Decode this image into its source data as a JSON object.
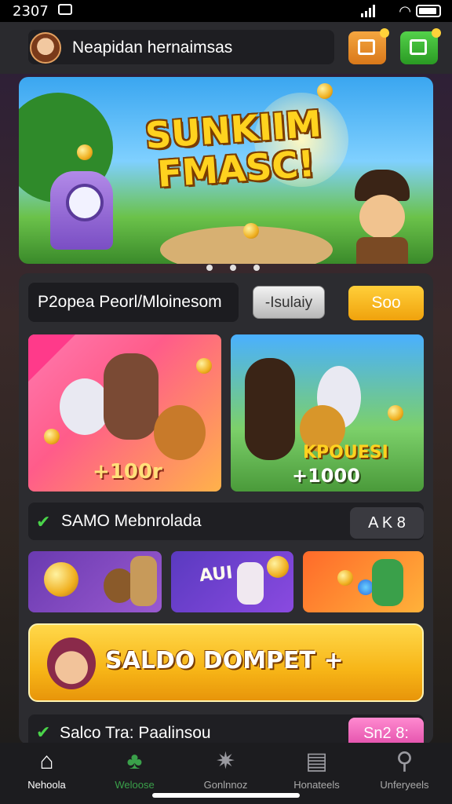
{
  "status_bar": {
    "time": "2307"
  },
  "header": {
    "username": "Neapidan hernaimsas"
  },
  "banner": {
    "title_line1": "SUNKIIM",
    "title_line2": "FMASC!",
    "carousel_active": 1,
    "carousel_count": 3
  },
  "promo": {
    "field_text": "P2opea Peorl/Mloinesom",
    "grey_button": "-Isulaiy",
    "orange_button": "Soo"
  },
  "cards": [
    {
      "amount": "+100r"
    },
    {
      "tag": "KPOUESI",
      "amount": "+1000"
    }
  ],
  "section1": {
    "label": "SAMO Mebnrolada",
    "button": "A K 8"
  },
  "mini_cards": [
    {
      "text": ""
    },
    {
      "text": "AUI P"
    },
    {
      "text": ""
    }
  ],
  "saldo": {
    "label": "SALDO DOMPET +"
  },
  "section2": {
    "label": "Salco Tra: Paalinsou",
    "button": "Sn2 8:"
  },
  "nav": [
    {
      "label": "Nehoola",
      "icon": "home-icon",
      "active": true
    },
    {
      "label": "Weloose",
      "icon": "club-icon",
      "active": false
    },
    {
      "label": "Gonlnnoz",
      "icon": "compass-icon",
      "active": false
    },
    {
      "label": "Honateels",
      "icon": "document-icon",
      "active": false
    },
    {
      "label": "Unferyeels",
      "icon": "search-icon",
      "active": false
    }
  ],
  "colors": {
    "accent_orange": "#f7b517",
    "accent_green": "#4ad44a",
    "accent_pink": "#e04aa8"
  }
}
